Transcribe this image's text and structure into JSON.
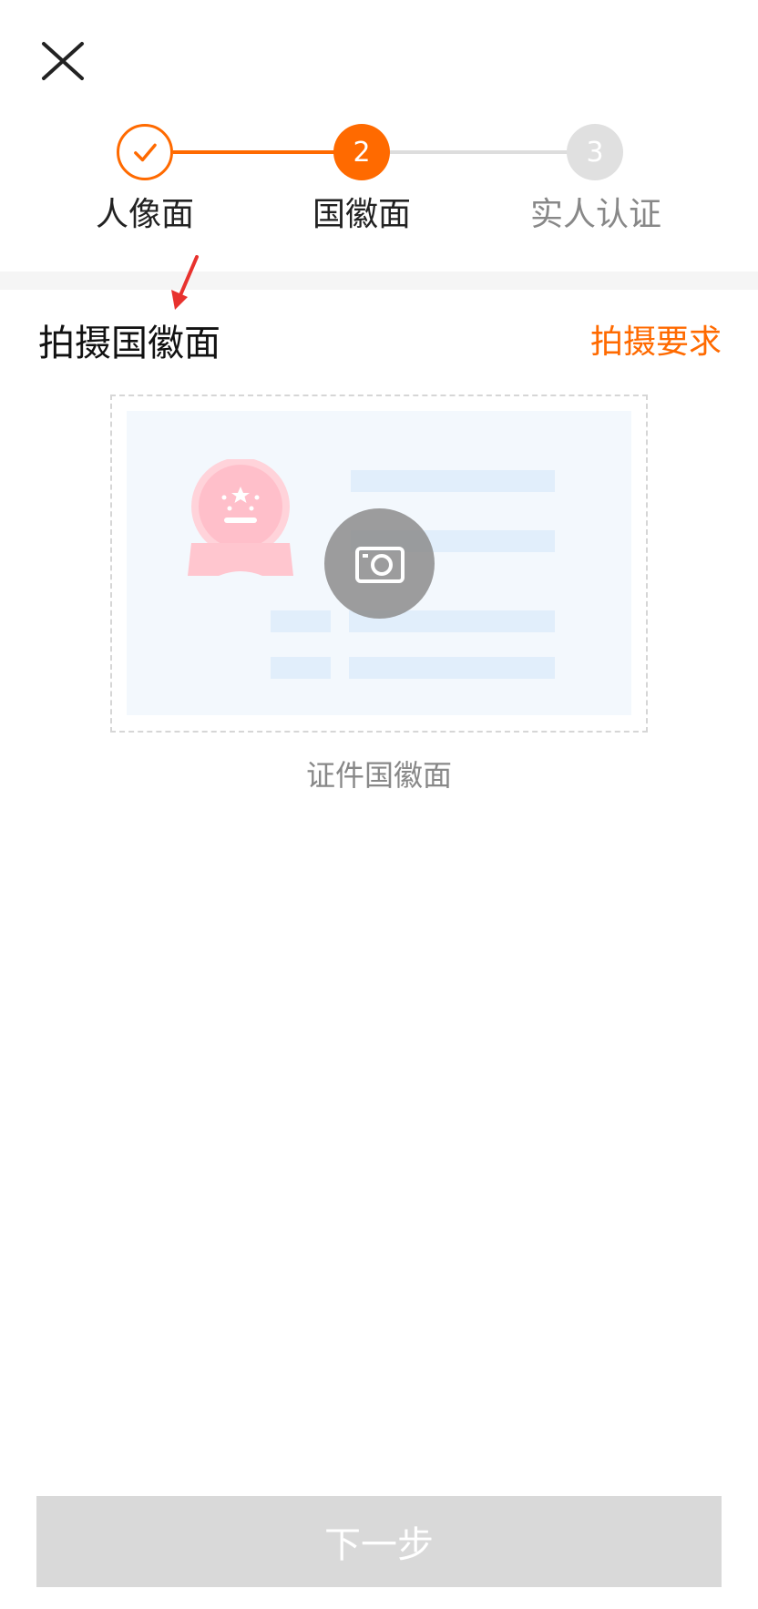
{
  "header": {
    "close_icon": "close-icon"
  },
  "steps": [
    {
      "label": "人像面",
      "state": "done",
      "icon": "check-icon"
    },
    {
      "label": "国徽面",
      "state": "active",
      "number": "2"
    },
    {
      "label": "实人认证",
      "state": "pending",
      "number": "3"
    }
  ],
  "section": {
    "title": "拍摄国徽面",
    "requirement_link": "拍摄要求"
  },
  "upload": {
    "caption": "证件国徽面",
    "camera_icon": "camera-icon",
    "emblem_icon": "national-emblem-icon"
  },
  "footer": {
    "next_label": "下一步"
  },
  "colors": {
    "accent": "#ff6a00",
    "pending": "#e0e0e0",
    "disabled_button": "#d9d9d9",
    "annotation_arrow": "#e8322e"
  }
}
